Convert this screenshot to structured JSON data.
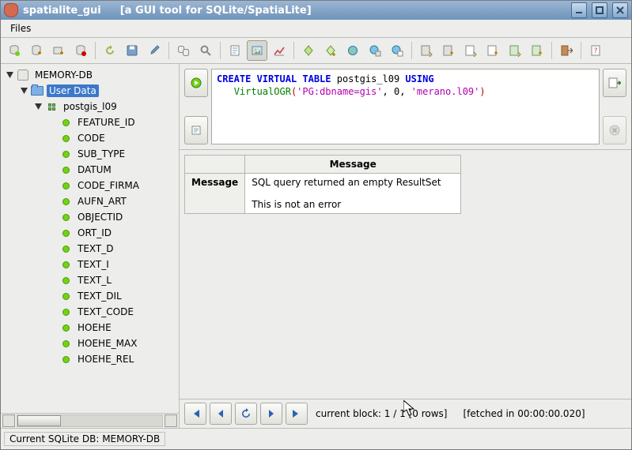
{
  "titlebar": {
    "app": "spatialite_gui",
    "caption": "[a GUI tool for SQLite/SpatiaLite]"
  },
  "menu": {
    "files": "Files"
  },
  "tree": {
    "root": "MEMORY-DB",
    "userdata": "User Data",
    "table": "postgis_l09",
    "cols": [
      "FEATURE_ID",
      "CODE",
      "SUB_TYPE",
      "DATUM",
      "CODE_FIRMA",
      "AUFN_ART",
      "OBJECTID",
      "ORT_ID",
      "TEXT_D",
      "TEXT_I",
      "TEXT_L",
      "TEXT_DIL",
      "TEXT_CODE",
      "HOEHE",
      "HOEHE_MAX",
      "HOEHE_REL"
    ]
  },
  "sql": {
    "kw_create": "CREATE VIRTUAL TABLE ",
    "ident": "postgis_l09 ",
    "kw_using": "USING",
    "indent": "   ",
    "fn": "VirtualOGR",
    "p_open": "(",
    "arg1": "'PG:dbname=gis'",
    "sep1": ", 0, ",
    "arg2": "'merano.l09'",
    "p_close": ")"
  },
  "results": {
    "header": "Message",
    "row_label": "Message",
    "cell": "SQL query returned an empty ResultSet\n\nThis is not an error"
  },
  "nav": {
    "block": "current block: 1 / 1 [0 rows]",
    "fetched": "[fetched in 00:00:00.020]"
  },
  "status": "Current SQLite DB: MEMORY-DB"
}
